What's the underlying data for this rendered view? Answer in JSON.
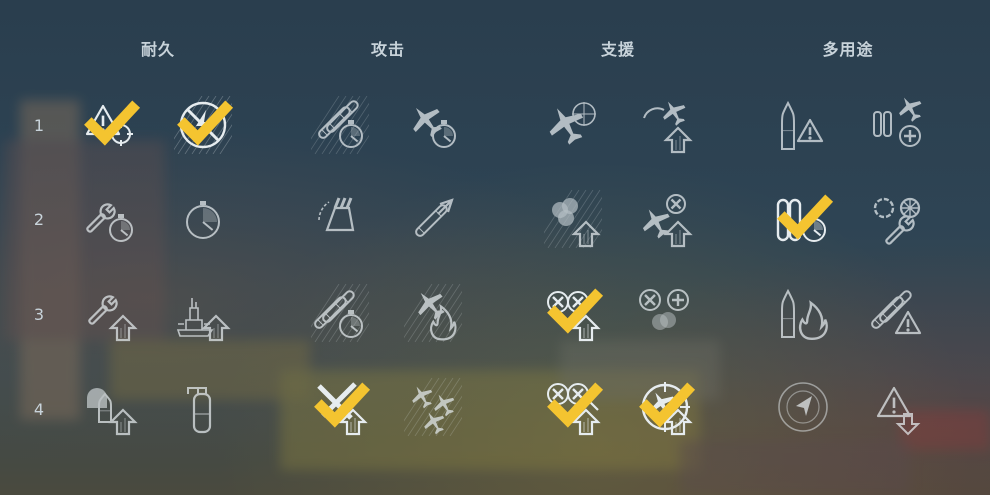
{
  "categories": [
    "耐久",
    "攻击",
    "支援",
    "多用途"
  ],
  "rows": [
    "1",
    "2",
    "3",
    "4"
  ],
  "colors": {
    "icon": "#e6ecef",
    "check": "#f4c430",
    "title": "#c8d3da"
  },
  "skills": [
    {
      "cat": 0,
      "row": 0,
      "slot": 0,
      "icon": "warning-crosshair-icon",
      "learned": true
    },
    {
      "cat": 0,
      "row": 0,
      "slot": 1,
      "icon": "no-fire-circle-icon",
      "learned": true
    },
    {
      "cat": 0,
      "row": 1,
      "slot": 0,
      "icon": "wrench-timer-icon",
      "learned": false
    },
    {
      "cat": 0,
      "row": 1,
      "slot": 1,
      "icon": "stopwatch-icon",
      "learned": false
    },
    {
      "cat": 0,
      "row": 2,
      "slot": 0,
      "icon": "wrench-upgrade-icon",
      "learned": false
    },
    {
      "cat": 0,
      "row": 2,
      "slot": 1,
      "icon": "battleship-upgrade-icon",
      "learned": false
    },
    {
      "cat": 0,
      "row": 3,
      "slot": 0,
      "icon": "shells-upgrade-icon",
      "learned": false
    },
    {
      "cat": 0,
      "row": 3,
      "slot": 1,
      "icon": "extinguisher-icon",
      "learned": false
    },
    {
      "cat": 1,
      "row": 0,
      "slot": 0,
      "icon": "torpedo-timer-icon",
      "learned": false
    },
    {
      "cat": 1,
      "row": 0,
      "slot": 1,
      "icon": "plane-timer-icon",
      "learned": false
    },
    {
      "cat": 1,
      "row": 1,
      "slot": 0,
      "icon": "turret-traverse-icon",
      "learned": false
    },
    {
      "cat": 1,
      "row": 1,
      "slot": 1,
      "icon": "torpedo-speed-icon",
      "learned": false
    },
    {
      "cat": 1,
      "row": 2,
      "slot": 0,
      "icon": "torpedo-reload-icon",
      "learned": false
    },
    {
      "cat": 1,
      "row": 2,
      "slot": 1,
      "icon": "plane-fire-icon",
      "learned": false
    },
    {
      "cat": 1,
      "row": 3,
      "slot": 0,
      "icon": "crossed-guns-upgrade-icon",
      "learned": true
    },
    {
      "cat": 1,
      "row": 3,
      "slot": 1,
      "icon": "aa-burst-icon",
      "learned": false
    },
    {
      "cat": 2,
      "row": 0,
      "slot": 0,
      "icon": "plane-crosshair-icon",
      "learned": false
    },
    {
      "cat": 2,
      "row": 0,
      "slot": 1,
      "icon": "plane-reload-upgrade-icon",
      "learned": false
    },
    {
      "cat": 2,
      "row": 1,
      "slot": 0,
      "icon": "smoke-upgrade-icon",
      "learned": false
    },
    {
      "cat": 2,
      "row": 1,
      "slot": 1,
      "icon": "aa-plane-upgrade-icon",
      "learned": false
    },
    {
      "cat": 2,
      "row": 2,
      "slot": 0,
      "icon": "aa-bursts-upgrade-icon",
      "learned": true
    },
    {
      "cat": 2,
      "row": 2,
      "slot": 1,
      "icon": "aa-plus-smoke-icon",
      "learned": false
    },
    {
      "cat": 2,
      "row": 3,
      "slot": 0,
      "icon": "aa-bursts-double-upgrade-icon",
      "learned": true
    },
    {
      "cat": 2,
      "row": 3,
      "slot": 1,
      "icon": "plane-crosshair-upgrade-icon",
      "learned": true
    },
    {
      "cat": 3,
      "row": 0,
      "slot": 0,
      "icon": "shell-warning-icon",
      "learned": false
    },
    {
      "cat": 3,
      "row": 0,
      "slot": 1,
      "icon": "bomb-plane-plus-icon",
      "learned": false
    },
    {
      "cat": 3,
      "row": 1,
      "slot": 0,
      "icon": "shells-timer-icon",
      "learned": true
    },
    {
      "cat": 3,
      "row": 1,
      "slot": 1,
      "icon": "wheels-wrench-icon",
      "learned": false
    },
    {
      "cat": 3,
      "row": 2,
      "slot": 0,
      "icon": "shell-fire-icon",
      "learned": false
    },
    {
      "cat": 3,
      "row": 2,
      "slot": 1,
      "icon": "torpedo-warning-icon",
      "learned": false
    },
    {
      "cat": 3,
      "row": 3,
      "slot": 0,
      "icon": "radar-compass-icon",
      "learned": false
    },
    {
      "cat": 3,
      "row": 3,
      "slot": 1,
      "icon": "warning-down-icon",
      "learned": false
    }
  ]
}
